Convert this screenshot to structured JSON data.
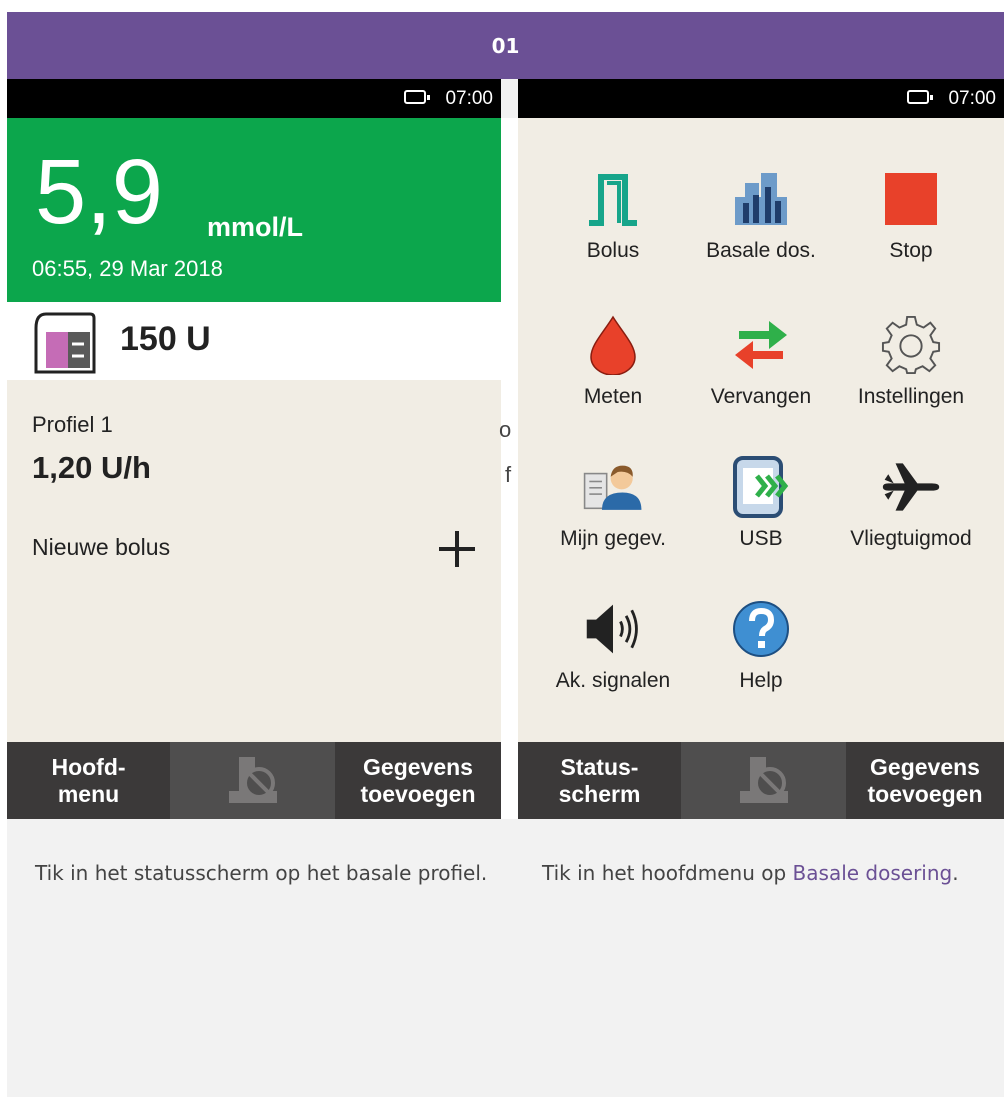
{
  "header": {
    "step": "01"
  },
  "left_screen": {
    "time": "07:00",
    "glucose_value": "5,9",
    "glucose_unit": "mmol/L",
    "glucose_timestamp": "06:55, 29 Mar 2018",
    "insulin_amount": "150 U",
    "profile_name": "Profiel 1",
    "basal_rate": "1,20 U/h",
    "new_bolus_label": "Nieuwe bolus",
    "bottom_left": [
      "Hoofd-",
      "menu"
    ],
    "bottom_right": [
      "Gegevens",
      "toevoegen"
    ]
  },
  "right_screen": {
    "time": "07:00",
    "menu_items": [
      {
        "label": "Bolus",
        "icon": "bolus-icon"
      },
      {
        "label": "Basale dos.",
        "icon": "basal-rate-icon"
      },
      {
        "label": "Stop",
        "icon": "stop-icon"
      },
      {
        "label": "Meten",
        "icon": "blood-drop-icon"
      },
      {
        "label": "Vervangen",
        "icon": "exchange-arrows-icon"
      },
      {
        "label": "Instellingen",
        "icon": "gear-icon"
      },
      {
        "label": "Mijn gegev.",
        "icon": "user-profile-icon"
      },
      {
        "label": "USB",
        "icon": "usb-device-icon"
      },
      {
        "label": "Vliegtuigmod",
        "icon": "airplane-icon"
      },
      {
        "label": "Ak. signalen",
        "icon": "speaker-icon"
      },
      {
        "label": "Help",
        "icon": "help-icon"
      }
    ],
    "bottom_left": [
      "Status-",
      "scherm"
    ],
    "bottom_right": [
      "Gegevens",
      "toevoegen"
    ]
  },
  "stray_chars": [
    "o",
    "f"
  ],
  "captions": {
    "left": "Tik in het statusscherm op het basale profiel.",
    "right_prefix": "Tik in het hoofdmenu op",
    "right_link": "Basale dosering",
    "right_suffix": "."
  },
  "colors": {
    "header": "#6b5095",
    "glucose_bg": "#0ca64c",
    "stop": "#e8412a",
    "help": "#3f8fd2"
  }
}
